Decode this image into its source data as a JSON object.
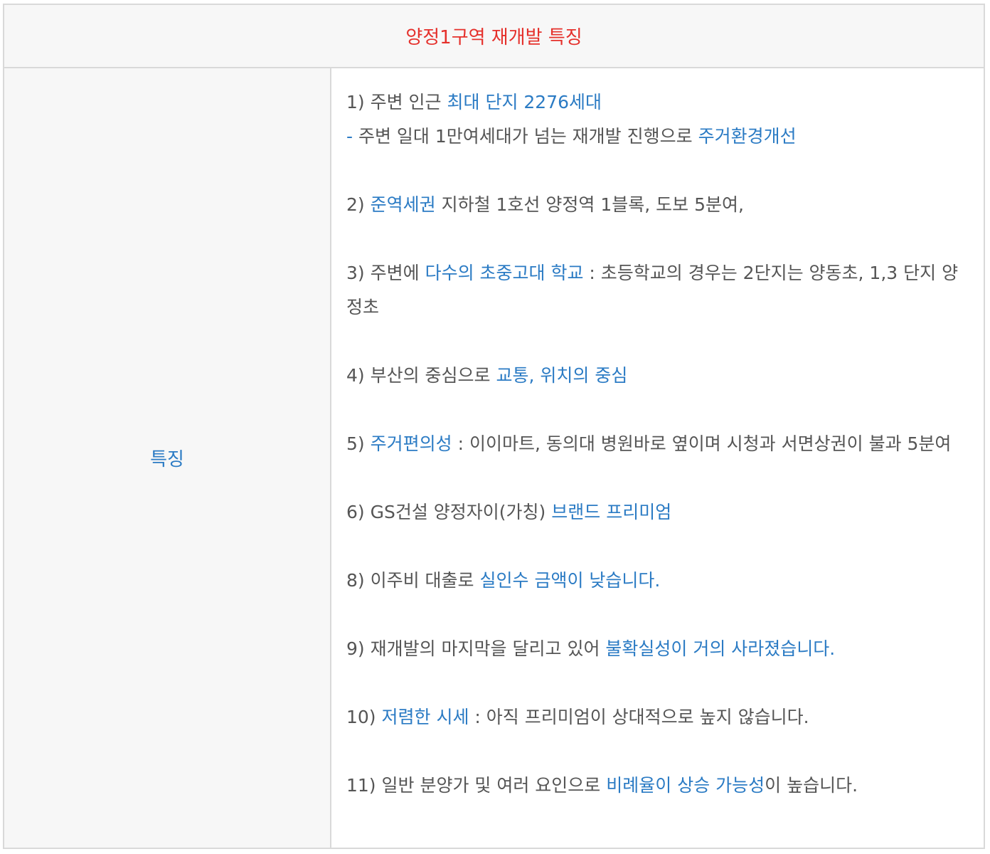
{
  "table": {
    "title": "양정1구역 재개발 특징",
    "row_label": "특징",
    "colors": {
      "title": "#e5302b",
      "highlight": "#2b7bc4",
      "text": "#555555",
      "cell_bg": "#f7f7f7",
      "border": "#d9d9d9"
    },
    "items": [
      {
        "lines": [
          {
            "text": "1) 주변 인근 ",
            "hl": "최대 단지 2276세대",
            "rest": ""
          },
          {
            "text": "",
            "hl": "-",
            "rest": " 주변 일대 1만여세대가 넘는 재개발 진행으로 ",
            "hl2": "주거환경개선"
          }
        ]
      },
      {
        "lines": [
          {
            "text": "2) ",
            "hl": "준역세권",
            "rest": " 지하철 1호선 양정역 1블록, 도보 5분여,"
          }
        ]
      },
      {
        "lines": [
          {
            "text": "3) 주변에 ",
            "hl": "다수의 초중고대 학교",
            "rest": " : 초등학교의 경우는 2단지는 양동초, 1,3 단지 양정초"
          }
        ]
      },
      {
        "lines": [
          {
            "text": "4) 부산의 중심으로 ",
            "hl": "교통, 위치의 중심",
            "rest": ""
          }
        ]
      },
      {
        "lines": [
          {
            "text": "5) ",
            "hl": "주거편의성",
            "rest": " : 이이마트, 동의대 병원바로 옆이며 시청과 서면상권이 불과 5분여"
          }
        ]
      },
      {
        "lines": [
          {
            "text": "6) GS건설 양정자이(가칭) ",
            "hl": "브랜드 프리미엄",
            "rest": ""
          }
        ]
      },
      {
        "lines": [
          {
            "text": "8) 이주비 대출로 ",
            "hl": "실인수 금액이 낮습니다.",
            "rest": ""
          }
        ]
      },
      {
        "lines": [
          {
            "text": "9) 재개발의 마지막을 달리고 있어 ",
            "hl": "불확실성이 거의 사라졌습니다.",
            "rest": ""
          }
        ]
      },
      {
        "lines": [
          {
            "text": "10) ",
            "hl": "저렴한 시세",
            "rest": " : 아직 프리미엄이 상대적으로 높지 않습니다."
          }
        ]
      },
      {
        "lines": [
          {
            "text": "11) 일반 분양가 및 여러 요인으로 ",
            "hl": "비례율이 상승 가능성",
            "rest": "이 높습니다."
          }
        ]
      }
    ]
  }
}
